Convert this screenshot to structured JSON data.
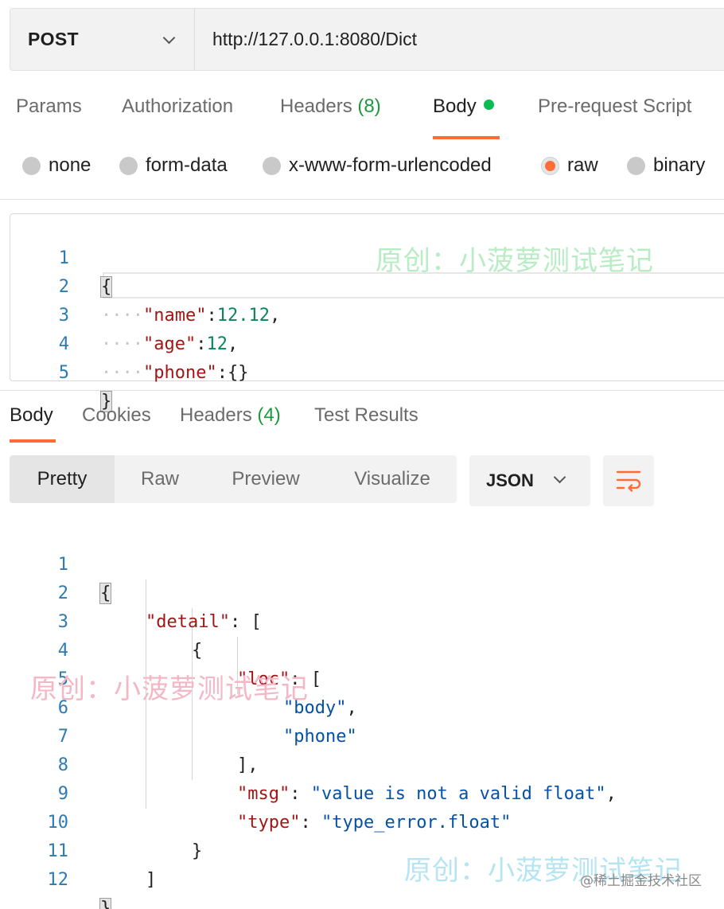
{
  "request": {
    "method": "POST",
    "url": "http://127.0.0.1:8080/Dict"
  },
  "request_tabs": {
    "params": "Params",
    "authorization": "Authorization",
    "headers": "Headers",
    "headers_count": "(8)",
    "body": "Body",
    "prerequest": "Pre-request Script",
    "active": "Body"
  },
  "body_types": {
    "none": "none",
    "form_data": "form-data",
    "urlencoded": "x-www-form-urlencoded",
    "raw": "raw",
    "binary": "binary",
    "selected": "raw"
  },
  "request_body": {
    "line_numbers": [
      "1",
      "2",
      "3",
      "4",
      "5"
    ],
    "open": "{",
    "close": "}",
    "indent": "····",
    "name_key": "\"name\"",
    "name_value": "12.12",
    "age_key": "\"age\"",
    "age_value": "12",
    "phone_key": "\"phone\"",
    "phone_value": "{}",
    "colon": ":",
    "comma": ","
  },
  "response_tabs": {
    "body": "Body",
    "cookies": "Cookies",
    "headers": "Headers",
    "headers_count": "(4)",
    "test_results": "Test Results",
    "active": "Body"
  },
  "view_modes": {
    "pretty": "Pretty",
    "raw": "Raw",
    "preview": "Preview",
    "visualize": "Visualize",
    "active": "Pretty"
  },
  "format": "JSON",
  "icons": {
    "format_dropdown": "chevron-down-icon",
    "method_dropdown": "chevron-down-icon",
    "wrap": "wrap-lines-icon"
  },
  "response_body": {
    "line_numbers": [
      "1",
      "2",
      "3",
      "4",
      "5",
      "6",
      "7",
      "8",
      "9",
      "10",
      "11",
      "12"
    ],
    "open": "{",
    "detail_key": "\"detail\"",
    "colon_space": ": ",
    "array_open": "[",
    "obj_open": "{",
    "loc_key": "\"loc\"",
    "loc_item1": "\"body\"",
    "comma": ",",
    "loc_item2": "\"phone\"",
    "array_close_comma": "],",
    "msg_key": "\"msg\"",
    "msg_value": "\"value is not a valid float\"",
    "type_key": "\"type\"",
    "type_value": "\"type_error.float\"",
    "obj_close": "}",
    "array_close": "]",
    "close": "}"
  },
  "watermark": "原创：小菠萝测试笔记",
  "footer": "@稀土掘金技术社区",
  "colors": {
    "accent": "#ff6c37",
    "status_green": "#0cbb52",
    "count_green": "#1a9a3c",
    "json_key": "#a31515",
    "json_string": "#0451a5",
    "json_number": "#098658",
    "line_number": "#2d7bb0"
  }
}
